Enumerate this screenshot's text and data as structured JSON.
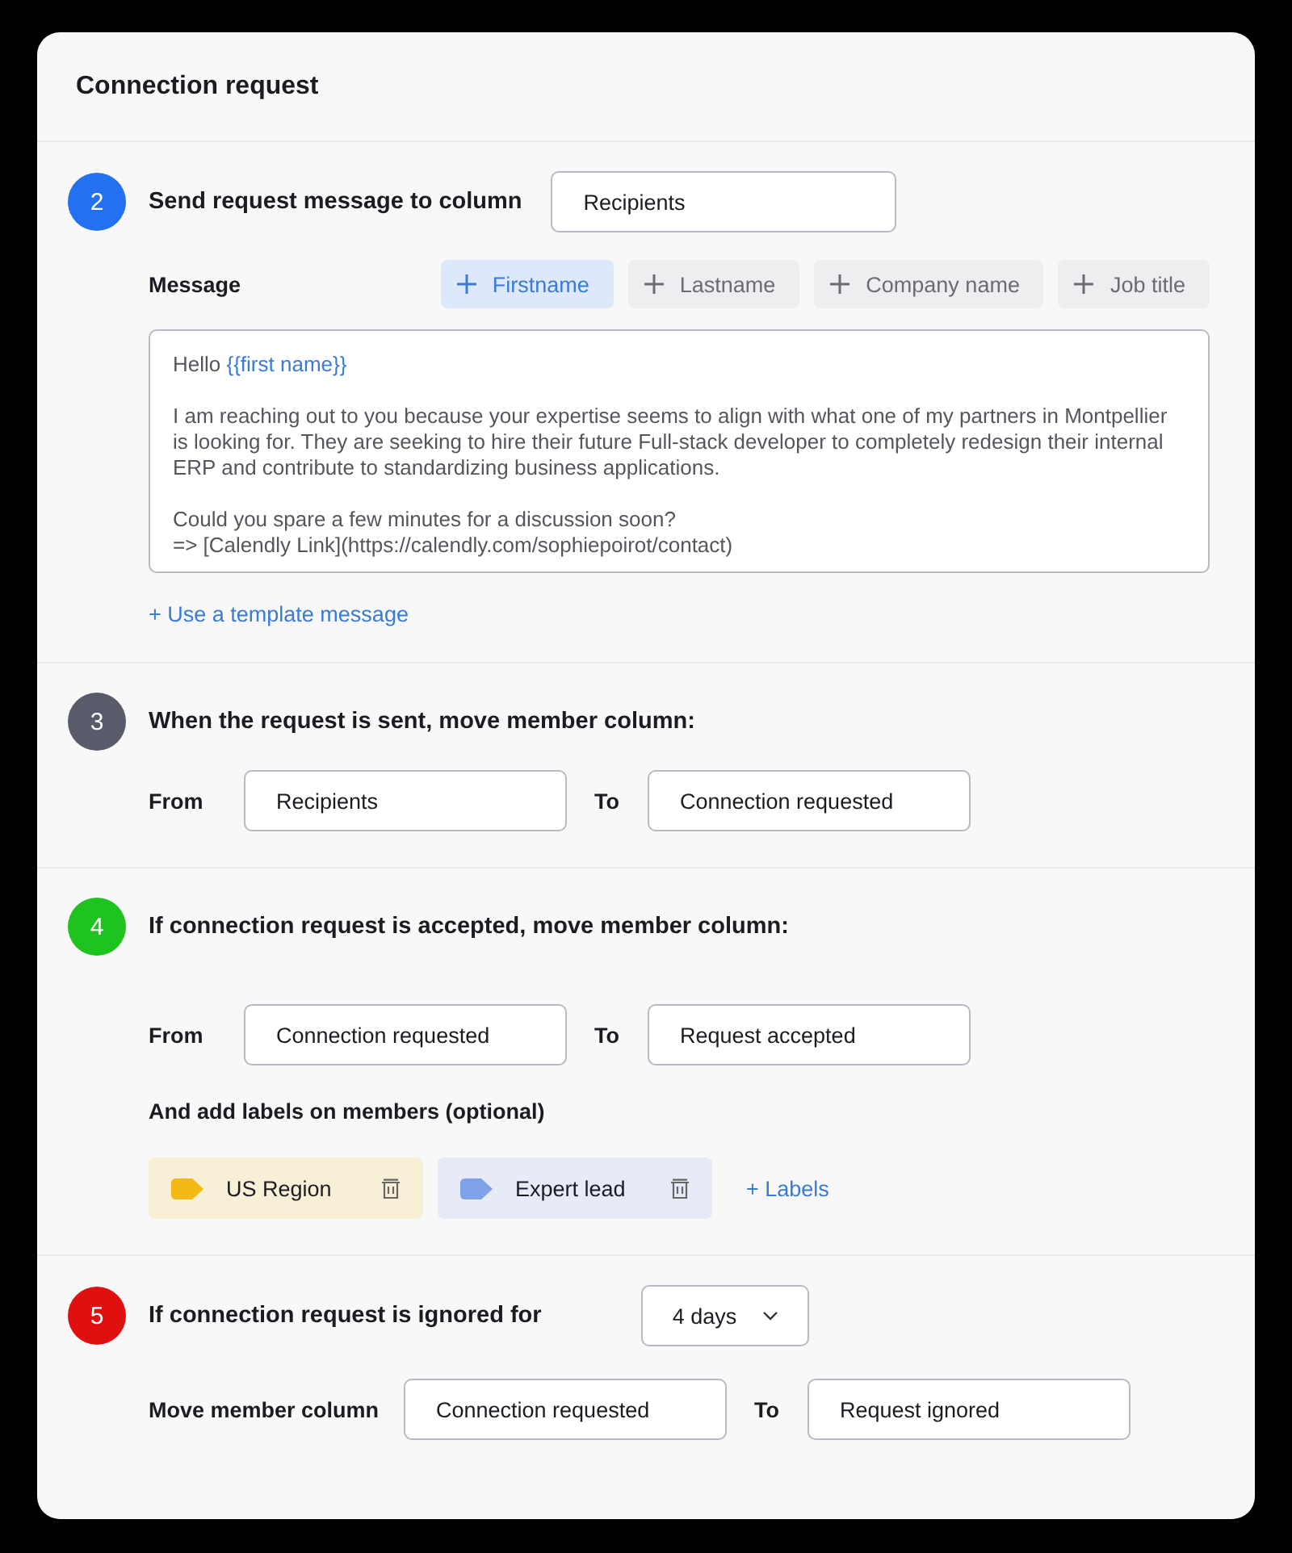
{
  "title": "Connection request",
  "steps": [
    {
      "number": "2",
      "color": "#2370f0",
      "heading": "Send request message to column",
      "column": "Recipients",
      "message": {
        "label": "Message",
        "variables": [
          {
            "label": "Firstname",
            "selected": true
          },
          {
            "label": "Lastname",
            "selected": false
          },
          {
            "label": "Company name",
            "selected": false
          },
          {
            "label": "Job title",
            "selected": false
          }
        ],
        "greeting": "Hello",
        "variable": "{{first name}}",
        "paragraphs": [
          [
            "I am reaching out to you because your expertise seems to align with what one of my partners in Montpellier is looking for. They are seeking to hire their future Full-stack developer to completely redesign their internal ERP and contribute to standardizing business applications."
          ],
          [
            "Could you spare a few minutes for a discussion soon?",
            "=> [Calendly Link](https://calendly.com/sophiepoirot/contact)"
          ]
        ],
        "template_link": "+ Use a template message"
      }
    },
    {
      "number": "3",
      "color": "#5a5b6a",
      "heading": "When the request is sent, move member column:",
      "move": {
        "from_label": "From",
        "from": "Recipients",
        "to_label": "To",
        "to": "Connection requested"
      }
    },
    {
      "number": "4",
      "color": "#1ec31e",
      "heading": "If connection request is accepted, move member column:",
      "move": {
        "from_label": "From",
        "from": "Connection requested",
        "to_label": "To",
        "to": "Request accepted"
      },
      "labels_heading": "And add labels on members (optional)",
      "labels": [
        {
          "name": "US Region",
          "color": "#f5b916"
        },
        {
          "name": "Expert lead",
          "color": "#7fa1e8"
        }
      ],
      "add_label": "+ Labels"
    },
    {
      "number": "5",
      "color": "#e01010",
      "heading": "If connection request is ignored for",
      "dropdown": "4 days",
      "move": {
        "from_label": "Move member column",
        "from": "Connection requested",
        "to_label": "To",
        "to": "Request ignored"
      }
    }
  ]
}
